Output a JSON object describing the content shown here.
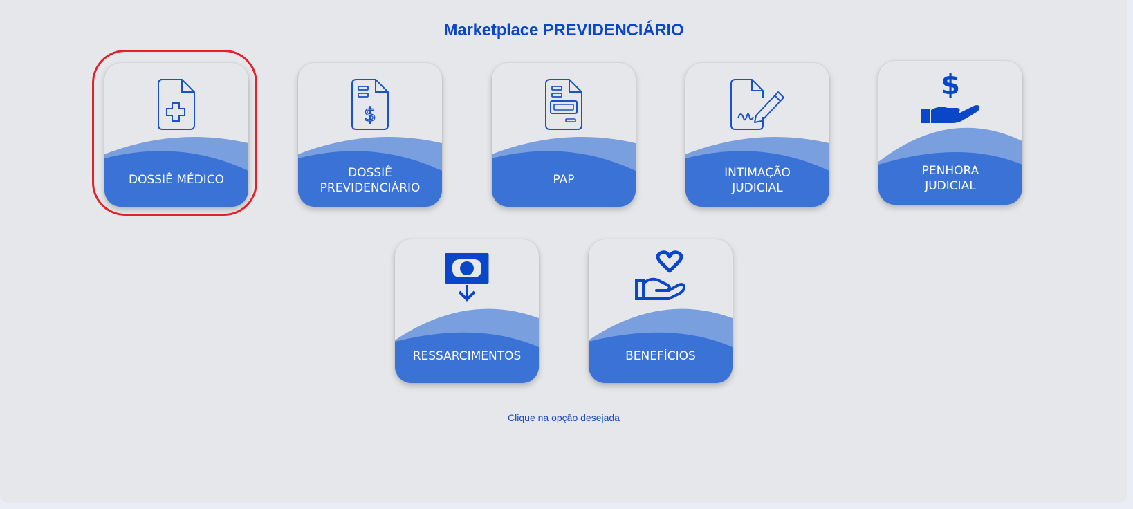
{
  "page": {
    "title": "Marketplace PREVIDENCIÁRIO",
    "hint": "Clique na opção desejada"
  },
  "colors": {
    "background": "#e6e7ea",
    "accent": "#0a46c8",
    "wave_dark": "#3a72d6",
    "wave_light": "#7a9fdf",
    "selection": "#e0222a"
  },
  "cards": [
    {
      "label": "DOSSIÊ MÉDICO",
      "icon": "medical-document-icon",
      "selected": true
    },
    {
      "label": "DOSSIÊ\nPREVIDENCIÁRIO",
      "icon": "money-document-icon",
      "selected": false
    },
    {
      "label": "PAP",
      "icon": "form-document-icon",
      "selected": false
    },
    {
      "label": "INTIMAÇÃO\nJUDICIAL",
      "icon": "signed-document-icon",
      "selected": false
    },
    {
      "label": "PENHORA\nJUDICIAL",
      "icon": "hand-dollar-icon",
      "selected": false
    },
    {
      "label": "RESSARCIMENTOS",
      "icon": "cash-download-icon",
      "selected": false
    },
    {
      "label": "BENEFÍCIOS",
      "icon": "hand-heart-icon",
      "selected": false
    }
  ]
}
